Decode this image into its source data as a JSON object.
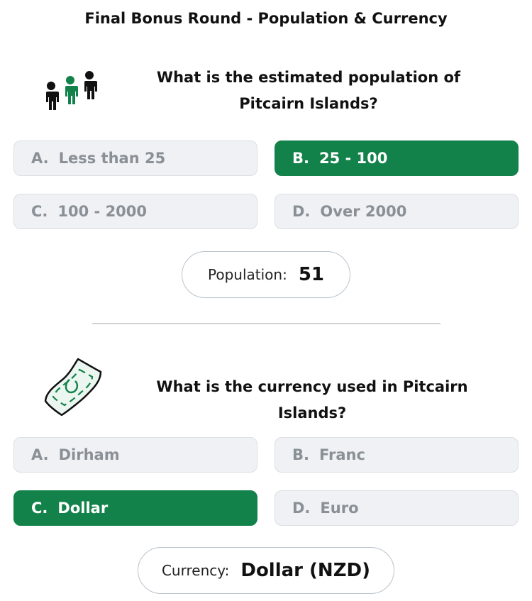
{
  "title": "Final Bonus Round - Population & Currency",
  "accent_color": "#13824a",
  "population_section": {
    "icon": "people-icon",
    "question": "What is the estimated population of Pitcairn Islands?",
    "options": [
      {
        "letter": "A.",
        "text": "Less than 25",
        "selected": false
      },
      {
        "letter": "B.",
        "text": "25 - 100",
        "selected": true
      },
      {
        "letter": "C.",
        "text": "100 - 2000",
        "selected": false
      },
      {
        "letter": "D.",
        "text": "Over 2000",
        "selected": false
      }
    ],
    "result_label": "Population:",
    "result_value": "51"
  },
  "currency_section": {
    "icon": "banknote-icon",
    "question": "What is the currency used in Pitcairn Islands?",
    "options": [
      {
        "letter": "A.",
        "text": "Dirham",
        "selected": false
      },
      {
        "letter": "B.",
        "text": "Franc",
        "selected": false
      },
      {
        "letter": "C.",
        "text": "Dollar",
        "selected": true
      },
      {
        "letter": "D.",
        "text": "Euro",
        "selected": false
      }
    ],
    "result_label": "Currency:",
    "result_value": "Dollar (NZD)"
  }
}
